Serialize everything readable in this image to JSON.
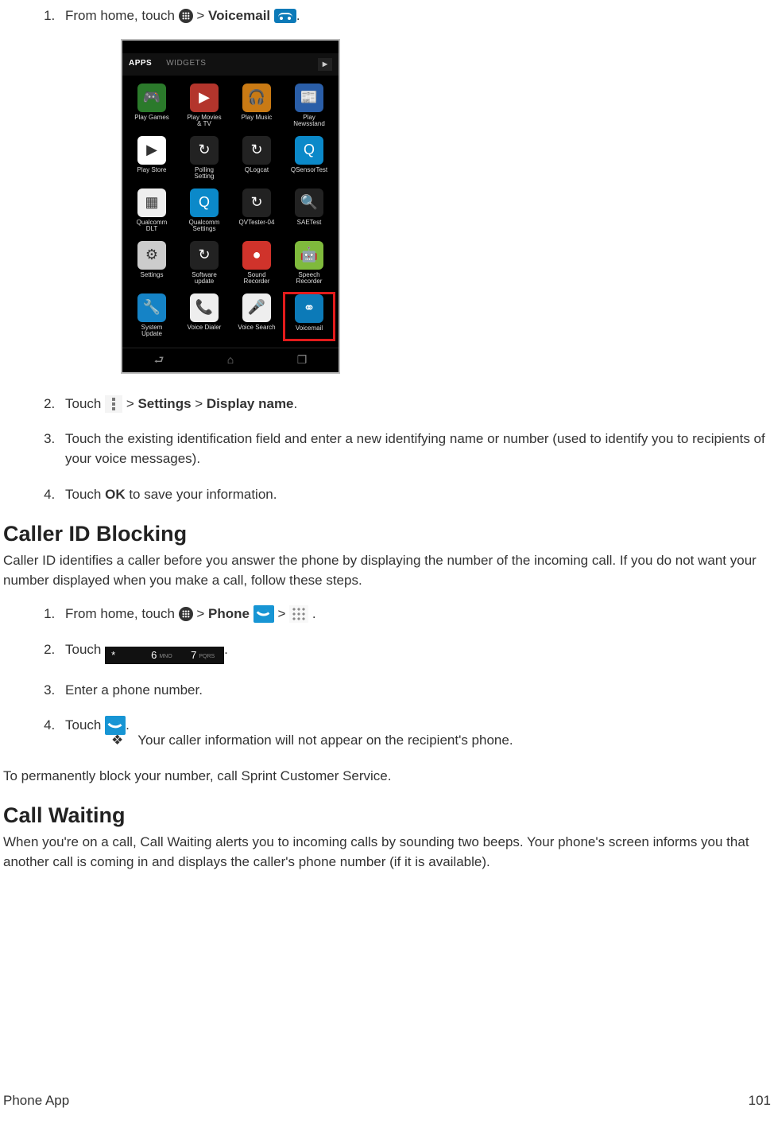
{
  "list1": {
    "item1_pre": "From home, touch ",
    "item1_gt": " > ",
    "item1_voicemail": "Voicemail",
    "item1_end": ".",
    "item2_pre": "Touch ",
    "item2_gt1": " > ",
    "item2_settings": "Settings",
    "item2_gt2": " > ",
    "item2_display": "Display name",
    "item2_end": ".",
    "item3": "Touch the existing identification field and enter a new identifying name or number (used to identify you to recipients of your voice messages).",
    "item4_pre": "Touch ",
    "item4_ok": "OK",
    "item4_end": " to save your information."
  },
  "phone": {
    "tab_apps": "APPS",
    "tab_widgets": "WIDGETS",
    "apps": [
      {
        "label": "Play Games",
        "bg": "#2b7a2b",
        "glyph": "🎮"
      },
      {
        "label": "Play Movies\n& TV",
        "bg": "#b3352c",
        "glyph": "▶"
      },
      {
        "label": "Play Music",
        "bg": "#c97a14",
        "glyph": "🎧"
      },
      {
        "label": "Play\nNewsstand",
        "bg": "#2a5ea8",
        "glyph": "📰"
      },
      {
        "label": "Play Store",
        "bg": "#fff",
        "glyph": "▶"
      },
      {
        "label": "Polling\nSetting",
        "bg": "#222",
        "glyph": "↻"
      },
      {
        "label": "QLogcat",
        "bg": "#222",
        "glyph": "↻"
      },
      {
        "label": "QSensorTest",
        "bg": "#0b89c9",
        "glyph": "Q"
      },
      {
        "label": "Qualcomm\nDLT",
        "bg": "#eee",
        "glyph": "▦"
      },
      {
        "label": "Qualcomm\nSettings",
        "bg": "#0b89c9",
        "glyph": "Q"
      },
      {
        "label": "QVTester-04",
        "bg": "#222",
        "glyph": "↻"
      },
      {
        "label": "SAETest",
        "bg": "#222",
        "glyph": "🔍"
      },
      {
        "label": "Settings",
        "bg": "#ccc",
        "glyph": "⚙"
      },
      {
        "label": "Software\nupdate",
        "bg": "#222",
        "glyph": "↻"
      },
      {
        "label": "Sound\nRecorder",
        "bg": "#d0332b",
        "glyph": "●"
      },
      {
        "label": "Speech\nRecorder",
        "bg": "#7fba3c",
        "glyph": "🤖"
      },
      {
        "label": "System\nUpdate",
        "bg": "#1583c6",
        "glyph": "🔧"
      },
      {
        "label": "Voice Dialer",
        "bg": "#eee",
        "glyph": "📞"
      },
      {
        "label": "Voice Search",
        "bg": "#eee",
        "glyph": "🎤"
      },
      {
        "label": "Voicemail",
        "bg": "#0c7ab8",
        "glyph": "⚭",
        "hl": true
      }
    ]
  },
  "heading1": "Caller ID Blocking",
  "para1": "Caller ID identifies a caller before you answer the phone by displaying the number of the incoming call. If you do not want your number displayed when you make a call, follow these steps.",
  "list2": {
    "item1_pre": "From home, touch ",
    "item1_gt1": " > ",
    "item1_phone": "Phone",
    "item1_gt2": " > ",
    "item1_end": " .",
    "item2_pre": "Touch ",
    "item2_end": ".",
    "keys": {
      "k1": "*",
      "k2": "6",
      "k2s": "MNO",
      "k3": "7",
      "k3s": "PQRS"
    },
    "item3": "Enter a phone number.",
    "item4_pre": "Touch ",
    "item4_end": ".",
    "sub": "Your caller information will not appear on the recipient's phone."
  },
  "para2": "To permanently block your number, call Sprint Customer Service.",
  "heading2": "Call Waiting",
  "para3": "When you're on a call, Call Waiting alerts you to incoming calls by sounding two beeps. Your phone's screen informs you that another call is coming in and displays the caller's phone number (if it is available).",
  "footer": {
    "left": "Phone App",
    "right": "101"
  }
}
